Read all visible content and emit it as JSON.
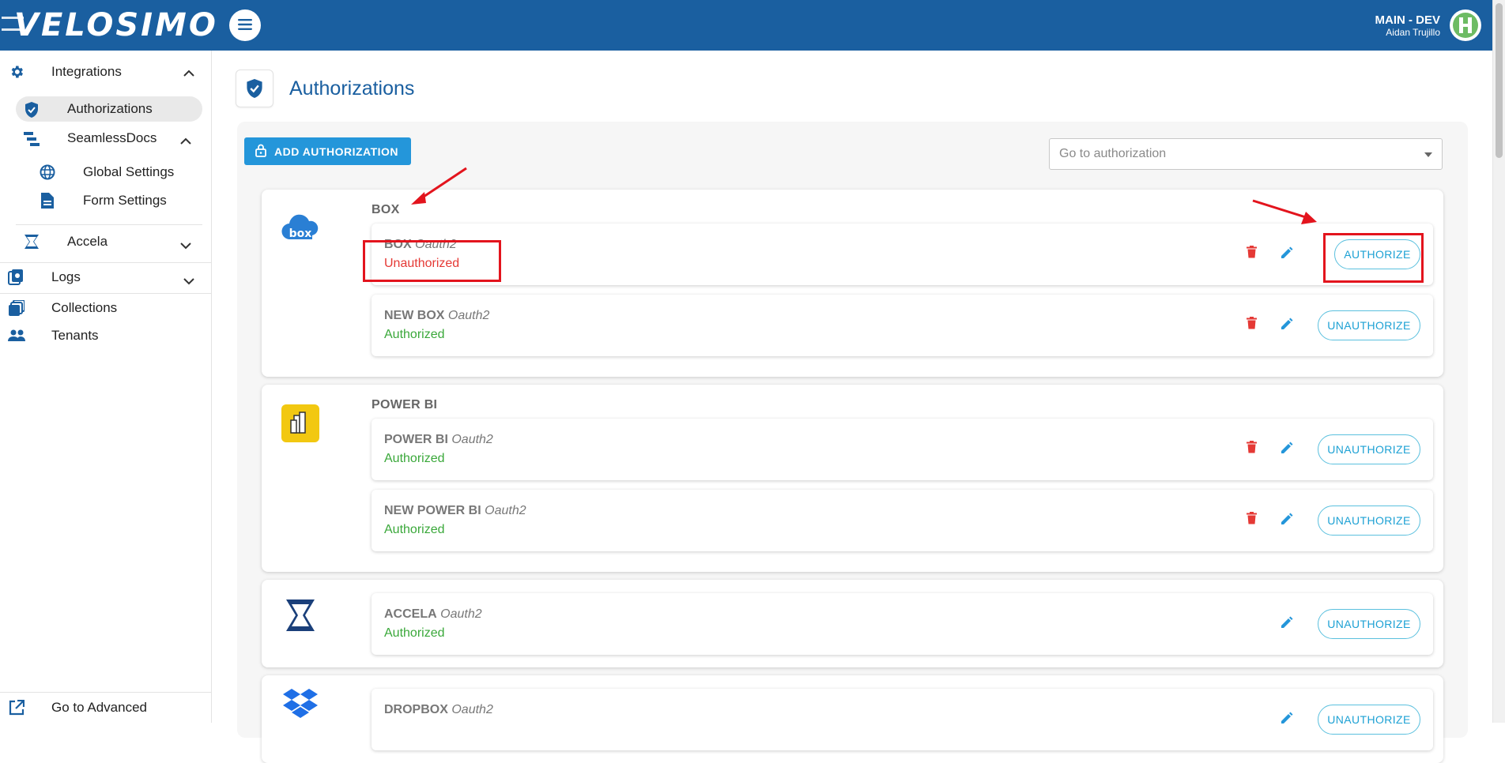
{
  "header": {
    "brand": "VELOSIMO",
    "env_name": "MAIN - DEV",
    "user_name": "Aidan Trujillo"
  },
  "sidebar": {
    "integrations": "Integrations",
    "authorizations": "Authorizations",
    "seamlessdocs": "SeamlessDocs",
    "global_settings": "Global Settings",
    "form_settings": "Form Settings",
    "accela": "Accela",
    "logs": "Logs",
    "collections": "Collections",
    "tenants": "Tenants",
    "go_advanced": "Go to Advanced"
  },
  "page": {
    "title": "Authorizations",
    "add_button": "ADD AUTHORIZATION",
    "goto_placeholder": "Go to authorization"
  },
  "groups": [
    {
      "name": "BOX",
      "items": [
        {
          "name": "BOX",
          "type": "Oauth2",
          "status": "Unauthorized",
          "action": "AUTHORIZE"
        },
        {
          "name": "NEW BOX",
          "type": "Oauth2",
          "status": "Authorized",
          "action": "UNAUTHORIZE"
        }
      ]
    },
    {
      "name": "POWER BI",
      "items": [
        {
          "name": "POWER BI",
          "type": "Oauth2",
          "status": "Authorized",
          "action": "UNAUTHORIZE"
        },
        {
          "name": "NEW POWER BI",
          "type": "Oauth2",
          "status": "Authorized",
          "action": "UNAUTHORIZE"
        }
      ]
    },
    {
      "name": "",
      "items": [
        {
          "name": "ACCELA",
          "type": "Oauth2",
          "status": "Authorized",
          "action": "UNAUTHORIZE"
        }
      ]
    },
    {
      "name": "",
      "items": [
        {
          "name": "DROPBOX",
          "type": "Oauth2",
          "status": "",
          "action": "UNAUTHORIZE"
        }
      ]
    }
  ],
  "colors": {
    "header_bg": "#1a5fa0",
    "primary": "#2496da",
    "authorized": "#3aa83a",
    "unauthorized": "#e53935",
    "delete": "#e53935",
    "annotation_red": "#e3141d"
  },
  "icons": {
    "menu": "hamburger-icon",
    "settings": "gear-icon",
    "shield": "shield-check-icon",
    "delete": "trash-icon",
    "edit": "pencil-icon",
    "lock": "lock-icon",
    "dropdown": "caret-down-icon"
  }
}
